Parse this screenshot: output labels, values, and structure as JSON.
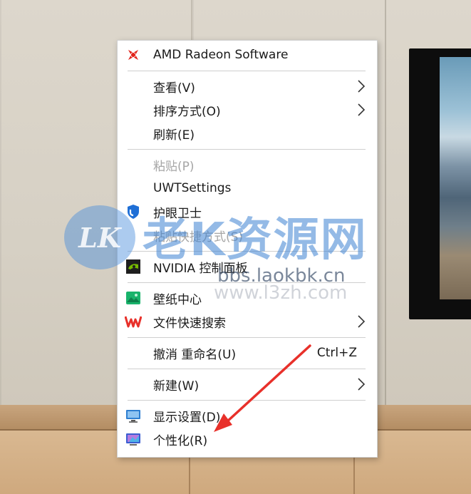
{
  "context_menu": {
    "items": [
      {
        "label": "AMD Radeon Software",
        "icon": "amd-radeon-icon"
      },
      {
        "label": "查看(V)",
        "submenu": true
      },
      {
        "label": "排序方式(O)",
        "submenu": true
      },
      {
        "label": "刷新(E)"
      },
      {
        "label": "粘贴(P)",
        "disabled": true
      },
      {
        "label": "UWTSettings"
      },
      {
        "label": "护眼卫士",
        "icon": "eye-guard-icon"
      },
      {
        "label": "粘贴快捷方式(S)",
        "disabled": true
      },
      {
        "label": "NVIDIA 控制面板",
        "icon": "nvidia-icon"
      },
      {
        "label": "壁纸中心",
        "icon": "wallpaper-center-icon"
      },
      {
        "label": "文件快速搜索",
        "icon": "wps-icon",
        "submenu": true
      },
      {
        "label": "撤消 重命名(U)",
        "shortcut": "Ctrl+Z"
      },
      {
        "label": "新建(W)",
        "submenu": true
      },
      {
        "label": "显示设置(D)",
        "icon": "display-settings-icon"
      },
      {
        "label": "个性化(R)",
        "icon": "personalize-icon"
      }
    ]
  },
  "watermark": {
    "logo_text": "LK",
    "title": "老K资源网",
    "url_primary": "bbs.laokbk.cn",
    "url_secondary": "www.l3zh.com"
  },
  "colors": {
    "menu_bg": "#ffffff",
    "disabled_text": "#a6a6a6",
    "annotation_arrow": "#e8302a",
    "amd_red": "#e2231a",
    "nvidia_green": "#76b900"
  }
}
